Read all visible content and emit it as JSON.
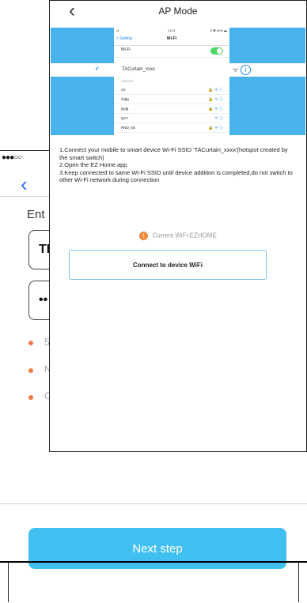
{
  "background": {
    "status_dots": "●●●○○",
    "back_glyph": "‹",
    "enter_label": "Ent",
    "ssid_value": "TF",
    "password_value": "••",
    "bullet_lines": [
      "5",
      "N",
      "C"
    ],
    "next_step_label": "Next step",
    "colors": {
      "accent": "#41bff0",
      "bullet": "#f07a4a"
    }
  },
  "modal": {
    "back_glyph": "‹",
    "title": "AP Mode",
    "screenshot": {
      "status_left": "•ıl",
      "status_center": "11:01",
      "status_right": "⊙ ✱ 60% ▬",
      "nav_back": "< Setting",
      "nav_title": "Wi-Fi",
      "wifi_label": "Wi-Fi",
      "selected_network": "TACurtain_xxxx",
      "choose_label": "CHOOSE",
      "networks": [
        {
          "name": "Air",
          "icons": "🔒 ᯤ ⓘ"
        },
        {
          "name": "cfqfg",
          "icons": "🔒 ᯤ ⓘ"
        },
        {
          "name": "jvjdg",
          "icons": "🔒 ᯤ ⓘ"
        },
        {
          "name": "QA7",
          "icons": "ᯤ ⓘ"
        },
        {
          "name": "RND_5G",
          "icons": "🔒 ᯤ ⓘ"
        }
      ]
    },
    "instructions": [
      "1.Connect your mobile to smart device Wi-Fi SSID 'TACurtain_xxxx'(hotspot created by the smart switch)",
      "2.Open the EZ Home app",
      "3.Keep connected to same Wi-Fi SSID until device addition is completed,do not switch to other Wi-Fi network during connection"
    ],
    "current_wifi_icon": "!",
    "current_wifi_text": "Current WiFi:EZHOME",
    "connect_button_label": "Connect to device WiFi"
  }
}
